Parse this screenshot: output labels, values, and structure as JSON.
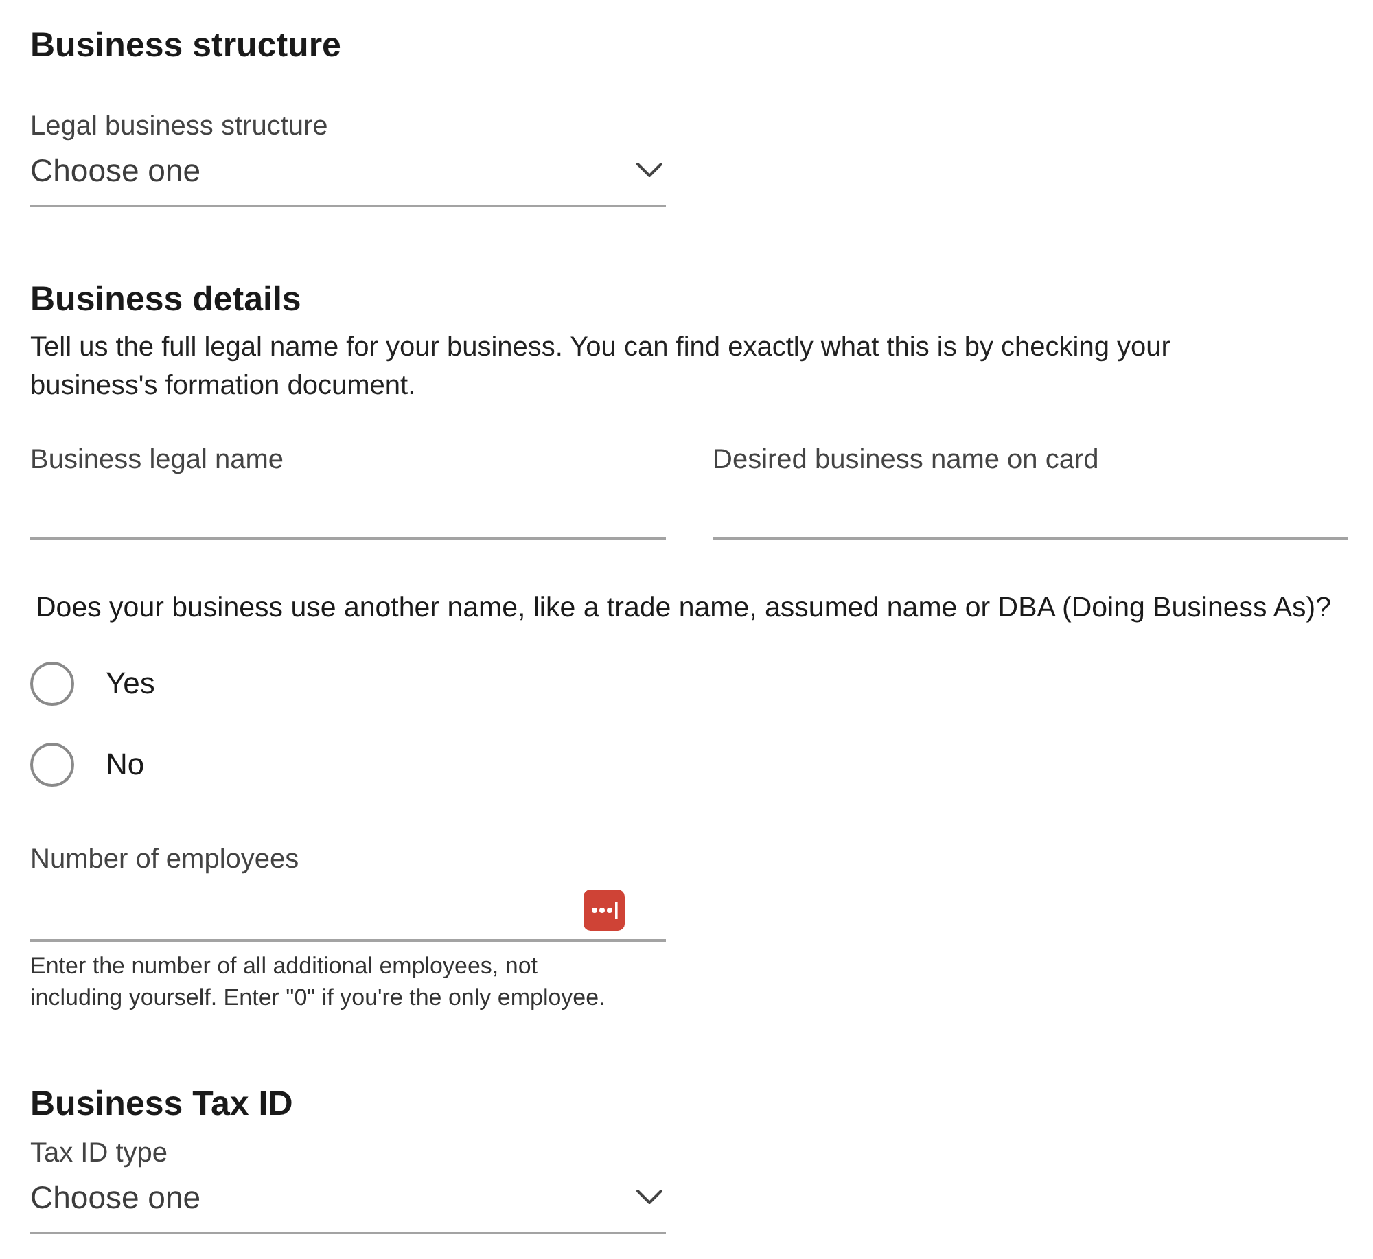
{
  "business_structure": {
    "heading": "Business structure",
    "select": {
      "label": "Legal business structure",
      "value": "Choose one"
    }
  },
  "business_details": {
    "heading": "Business details",
    "description": "Tell us the full legal name for your business. You can find exactly what this is by checking your business's formation document.",
    "fields": [
      {
        "label": "Business legal name"
      },
      {
        "label": "Desired business name on card"
      }
    ],
    "question": {
      "text": "Does your business use another name, like a trade name, assumed name or DBA (Doing Business As)?",
      "options": [
        {
          "label": "Yes",
          "selected": false
        },
        {
          "label": "No",
          "selected": false
        }
      ]
    },
    "employees": {
      "label": "Number of employees",
      "hint": "Enter the number of all additional employees, not including yourself. Enter \"0\" if you're the only employee."
    }
  },
  "business_tax_id": {
    "heading": "Business Tax ID",
    "select": {
      "label": "Tax ID type",
      "value": "Choose one"
    }
  }
}
